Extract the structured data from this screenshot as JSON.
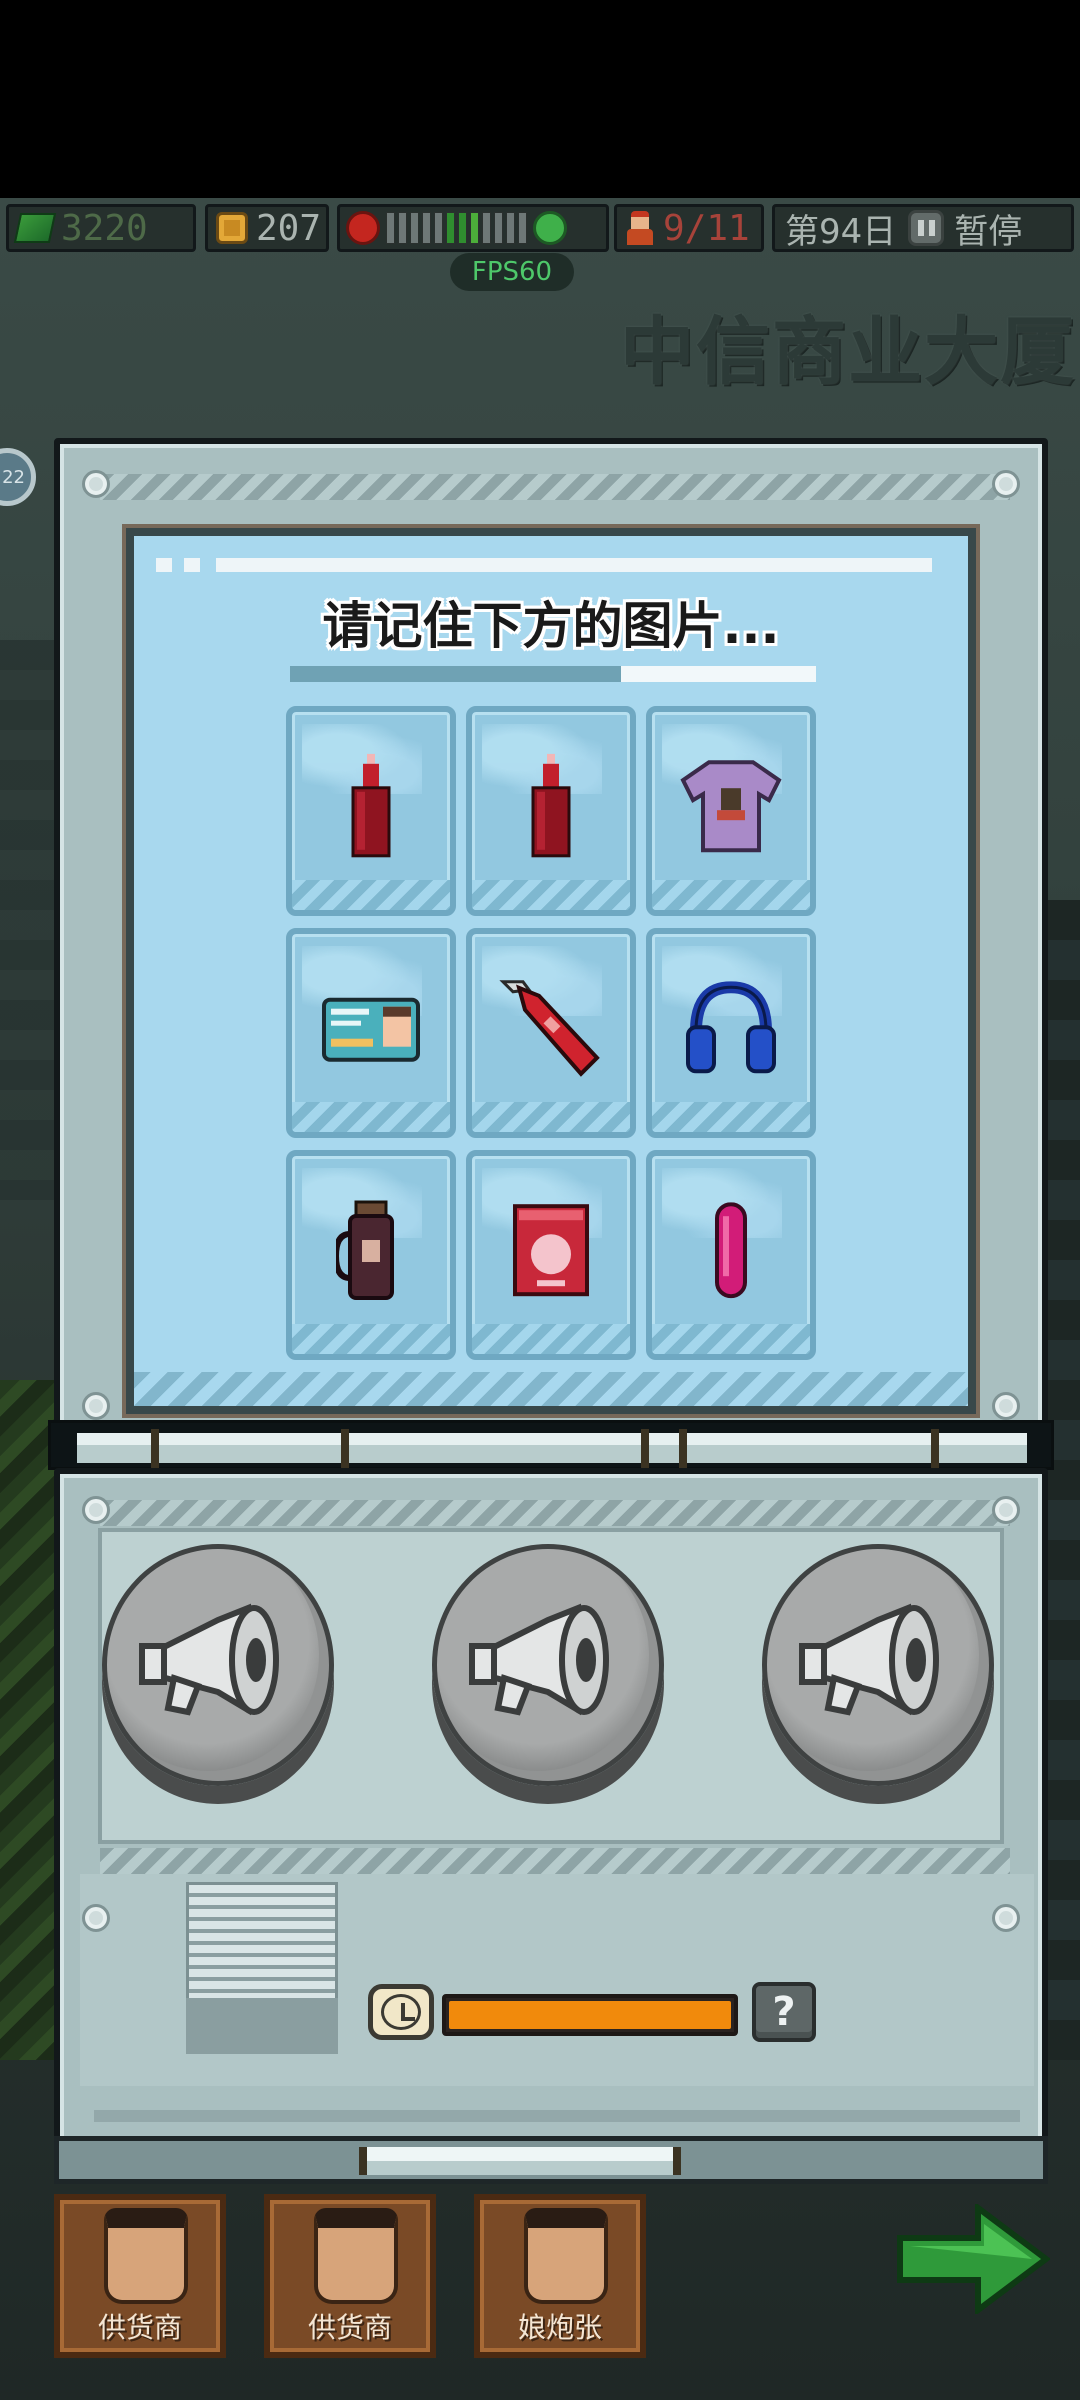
{
  "hud": {
    "money": "3220",
    "coins": "207",
    "staff": "9/11",
    "day": "第94日",
    "pause_label": "暂停"
  },
  "fps": "FPS60",
  "building_name": "中信商业大厦",
  "side_badge": "22",
  "memory_game": {
    "prompt": "请记住下方的图片...",
    "memorize_progress": 0.37,
    "items": [
      {
        "name": "red-bottle"
      },
      {
        "name": "red-bottle"
      },
      {
        "name": "purple-tshirt"
      },
      {
        "name": "id-card"
      },
      {
        "name": "utility-knife"
      },
      {
        "name": "blue-headphones"
      },
      {
        "name": "thermos-flask"
      },
      {
        "name": "red-book"
      },
      {
        "name": "pink-tube"
      }
    ],
    "sound_buttons": [
      "megaphone-icon",
      "megaphone-icon",
      "megaphone-icon"
    ],
    "timer_fill": 1.0,
    "help_label": "?"
  },
  "characters": [
    {
      "name": "供货商"
    },
    {
      "name": "供货商"
    },
    {
      "name": "娘炮张"
    }
  ],
  "colors": {
    "timer": "#f18a0c",
    "screen": "#a8d8ee",
    "panel": "#a9bfc0"
  }
}
